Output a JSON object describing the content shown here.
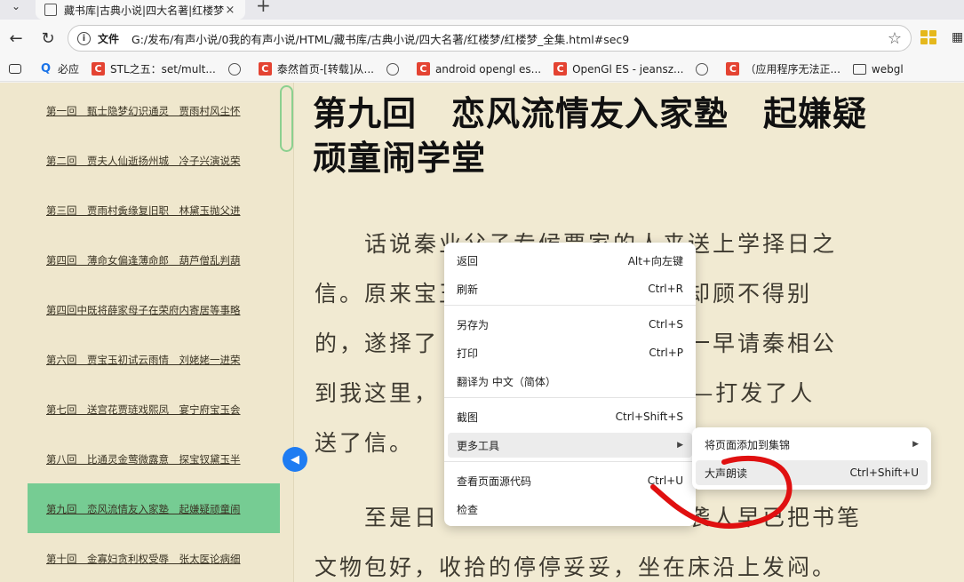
{
  "tab": {
    "title": "藏书库|古典小说|四大名著|红楼梦",
    "close": "×"
  },
  "new_tab": "+",
  "nav": {
    "back": "←",
    "reload": "↻",
    "info": "i",
    "scheme": "文件",
    "url": "G:/发布/有声小说/0我的有声小说/HTML/藏书库/古典小说/四大名著/红楼梦/红楼梦_全集.html#sec9",
    "star": "☆"
  },
  "bookmarks": [
    {
      "icon": "apps",
      "label": ""
    },
    {
      "icon": "search",
      "label": "必应"
    },
    {
      "icon": "redc",
      "label": "STL之五：set/mult..."
    },
    {
      "icon": "globe",
      "label": ""
    },
    {
      "icon": "redc",
      "label": "泰然首页-[转载]从..."
    },
    {
      "icon": "globe",
      "label": ""
    },
    {
      "icon": "redc",
      "label": "android opengl es..."
    },
    {
      "icon": "redc",
      "label": "OpenGl ES - jeansz..."
    },
    {
      "icon": "globe",
      "label": ""
    },
    {
      "icon": "redc",
      "label": "（应用程序无法正..."
    },
    {
      "icon": "folder",
      "label": "webgl"
    }
  ],
  "toc": [
    "第一回　甄士隐梦幻识通灵　贾雨村风尘怀",
    "第二回　贾夫人仙逝扬州城　冷子兴演说荣",
    "第三回　贾雨村夤缘复旧职　林黛玉抛父进",
    "第四回　薄命女偏逢薄命郎　葫芦僧乱判葫",
    "第四回中既将薛家母子在荣府内寄居等事略",
    "第六回　贾宝玉初试云雨情　刘姥姥一进荣",
    "第七回　送宫花贾琏戏熙凤　宴宁府宝玉会",
    "第八回　比通灵金莺微露意　探宝钗黛玉半",
    "第九回　恋风流情友入家塾　起嫌疑顽童闹",
    "第十回　金寡妇贪利权受辱　张太医论病细"
  ],
  "collapse_icon": "◀",
  "chapter_title": "第九回　恋风流情友入家塾　起嫌疑顽童闹学堂",
  "paragraph_lines": [
    "　　话说秦业父子专候贾家的人来送上学择日之",
    "信。原来宝玉　　　　　　　　　却顾不得别",
    "的，遂择了　　　　　　　　　日一早请秦相公",
    "到我这里，　　　　　　　　　”——打发了人",
    "送了信。",
    "　　至是日　　　　　　　　　　袭人早已把书笔",
    "文物包好，收拾的停停妥妥，坐在床沿上发闷。"
  ],
  "context_menu": {
    "items": [
      {
        "label": "返回",
        "shortcut": "Alt+向左键"
      },
      {
        "label": "刷新",
        "shortcut": "Ctrl+R"
      },
      {
        "label": "另存为",
        "shortcut": "Ctrl+S"
      },
      {
        "label": "打印",
        "shortcut": "Ctrl+P"
      },
      {
        "label": "翻译为 中文（简体）",
        "shortcut": ""
      },
      {
        "label": "截图",
        "shortcut": "Ctrl+Shift+S"
      },
      {
        "label": "更多工具",
        "shortcut": ""
      },
      {
        "label": "查看页面源代码",
        "shortcut": "Ctrl+U"
      },
      {
        "label": "检查",
        "shortcut": ""
      }
    ],
    "submenu_arrow": "▶"
  },
  "submenu": {
    "items": [
      {
        "label": "将页面添加到集锦",
        "shortcut": ""
      },
      {
        "label": "大声朗读",
        "shortcut": "Ctrl+Shift+U"
      }
    ]
  },
  "colors": {
    "annotation": "#e01010",
    "toc_active": "#76cc93",
    "page_bg": "#f1ead2"
  }
}
